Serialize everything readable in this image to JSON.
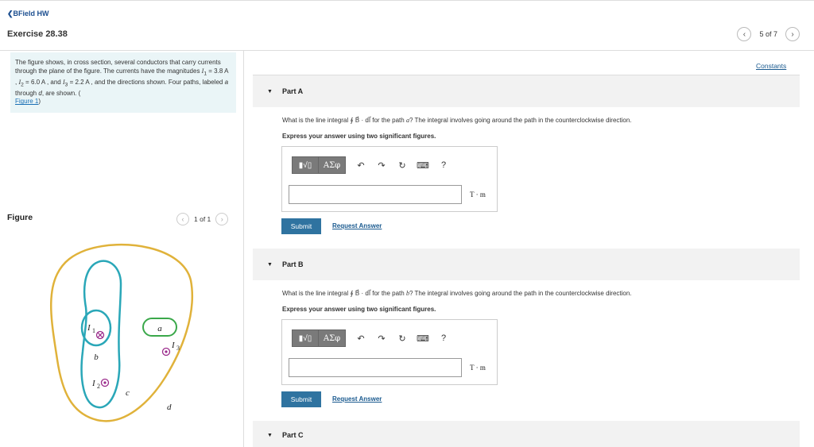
{
  "header": {
    "back_label": "BField HW",
    "exercise_title": "Exercise 28.38",
    "pager_text": "5 of 7"
  },
  "problem": {
    "text_part1": "The figure shows, in cross section, several conductors that carry currents through the plane of the figure. The currents have the magnitudes I",
    "text_full": "The figure shows, in cross section, several conductors that carry currents through the plane of the figure. The currents have the magnitudes I₁ = 3.8 A , I₂ = 6.0 A , and I₃ = 2.2 A , and the directions shown. Four paths, labeled a through d, are shown. (",
    "figure_link": "Figure 1",
    "close": ")"
  },
  "figure": {
    "label": "Figure",
    "pager_text": "1 of 1",
    "labels": {
      "I1": "I",
      "I1_sub": "1",
      "I2": "I",
      "I2_sub": "2",
      "I3": "I",
      "I3_sub": "3",
      "a": "a",
      "b": "b",
      "c": "c",
      "d": "d"
    },
    "colors": {
      "path_a": "#3aa84a",
      "path_b": "#2aa7b8",
      "path_c": "#2aa7b8",
      "path_d": "#e0b23a",
      "current": "#9b2c8c"
    }
  },
  "constants_label": "Constants",
  "parts": [
    {
      "title": "Part A",
      "question_pre": "What is the line integral ∮ B⃗ · dl⃗ for the path ",
      "path": "a",
      "question_post": "? The integral involves going around the path in the counterclockwise direction.",
      "instruction": "Express your answer using two significant figures.",
      "units": "T · m",
      "submit": "Submit",
      "request": "Request Answer"
    },
    {
      "title": "Part B",
      "question_pre": "What is the line integral ∮ B⃗ · dl⃗ for the path ",
      "path": "b",
      "question_post": "? The integral involves going around the path in the counterclockwise direction.",
      "instruction": "Express your answer using two significant figures.",
      "units": "T · m",
      "submit": "Submit",
      "request": "Request Answer"
    },
    {
      "title": "Part C"
    }
  ],
  "toolbar": {
    "templates_label": "▮√▯",
    "greek_label": "ΑΣφ",
    "undo_icon": "undo-icon",
    "redo_icon": "redo-icon",
    "reset_icon": "reset-icon",
    "keyboard_icon": "keyboard-icon",
    "help_label": "?"
  }
}
